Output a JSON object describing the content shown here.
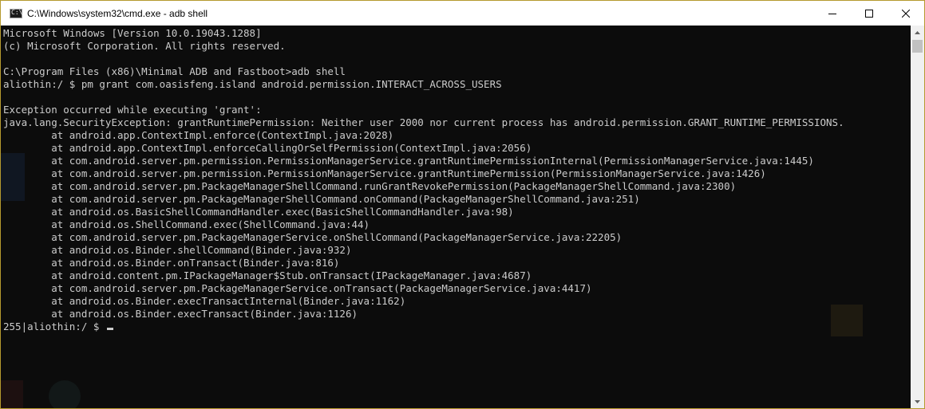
{
  "window": {
    "title": "C:\\Windows\\system32\\cmd.exe - adb  shell",
    "icon": "console-icon",
    "controls": [
      "minimize-icon",
      "maximize-icon",
      "close-icon"
    ]
  },
  "terminal": {
    "lines": [
      "Microsoft Windows [Version 10.0.19043.1288]",
      "(c) Microsoft Corporation. All rights reserved.",
      "",
      "C:\\Program Files (x86)\\Minimal ADB and Fastboot>adb shell",
      "aliothin:/ $ pm grant com.oasisfeng.island android.permission.INTERACT_ACROSS_USERS",
      "",
      "Exception occurred while executing 'grant':",
      "java.lang.SecurityException: grantRuntimePermission: Neither user 2000 nor current process has android.permission.GRANT_RUNTIME_PERMISSIONS.",
      "        at android.app.ContextImpl.enforce(ContextImpl.java:2028)",
      "        at android.app.ContextImpl.enforceCallingOrSelfPermission(ContextImpl.java:2056)",
      "        at com.android.server.pm.permission.PermissionManagerService.grantRuntimePermissionInternal(PermissionManagerService.java:1445)",
      "        at com.android.server.pm.permission.PermissionManagerService.grantRuntimePermission(PermissionManagerService.java:1426)",
      "        at com.android.server.pm.PackageManagerShellCommand.runGrantRevokePermission(PackageManagerShellCommand.java:2300)",
      "        at com.android.server.pm.PackageManagerShellCommand.onCommand(PackageManagerShellCommand.java:251)",
      "        at android.os.BasicShellCommandHandler.exec(BasicShellCommandHandler.java:98)",
      "        at android.os.ShellCommand.exec(ShellCommand.java:44)",
      "        at com.android.server.pm.PackageManagerService.onShellCommand(PackageManagerService.java:22205)",
      "        at android.os.Binder.shellCommand(Binder.java:932)",
      "        at android.os.Binder.onTransact(Binder.java:816)",
      "        at android.content.pm.IPackageManager$Stub.onTransact(IPackageManager.java:4687)",
      "        at com.android.server.pm.PackageManagerService.onTransact(PackageManagerService.java:4417)",
      "        at android.os.Binder.execTransactInternal(Binder.java:1162)",
      "        at android.os.Binder.execTransact(Binder.java:1126)"
    ],
    "prompt": "255|aliothin:/ $ "
  },
  "scrollbar": {
    "up": "scroll-up-arrow-icon",
    "down": "scroll-down-arrow-icon"
  },
  "colors": {
    "background": "#0c0c0c",
    "text": "#cccccc",
    "titlebar": "#ffffff",
    "border": "#b59a2e"
  }
}
